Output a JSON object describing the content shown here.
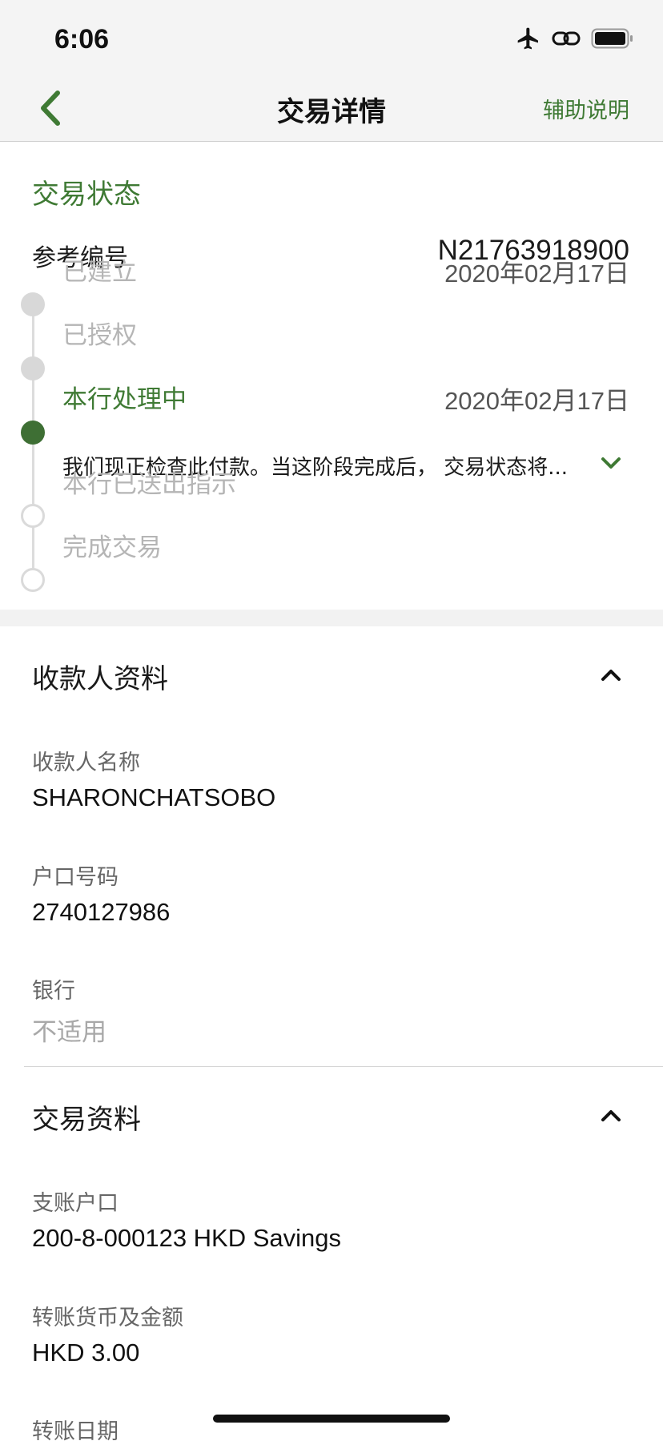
{
  "status_bar": {
    "time": "6:06",
    "icons": [
      "airplane-icon",
      "link-icon",
      "battery-icon"
    ]
  },
  "nav": {
    "title": "交易详情",
    "help_label": "辅助说明",
    "back_icon": "chevron-left-icon"
  },
  "transaction_status": {
    "heading": "交易状态",
    "reference_label": "参考编号",
    "reference_value": "N21763918900",
    "steps": [
      {
        "label": "已建立",
        "date": "2020年02月17日",
        "state": "done"
      },
      {
        "label": "已授权",
        "date": "",
        "state": "done"
      },
      {
        "label": "本行处理中",
        "date": "2020年02月17日",
        "state": "active",
        "description": "我们现正检查此付款。当这阶段完成后， 交易状态将..."
      },
      {
        "label": "本行已送出指示",
        "date": "",
        "state": "pending"
      },
      {
        "label": "完成交易",
        "date": "",
        "state": "pending"
      }
    ]
  },
  "payee_info": {
    "heading": "收款人资料",
    "fields": [
      {
        "label": "收款人名称",
        "value": "SHARONCHATSOBO"
      },
      {
        "label": "户口号码",
        "value": "2740127986"
      },
      {
        "label": "银行",
        "value": "不适用"
      }
    ]
  },
  "transaction_info": {
    "heading": "交易资料",
    "fields": [
      {
        "label": "支账户口",
        "value": "200-8-000123 HKD Savings"
      },
      {
        "label": "转账货币及金额",
        "value": "HKD 3.00"
      },
      {
        "label": "转账日期",
        "value": ""
      }
    ]
  },
  "colors": {
    "accent_green": "#3f7a34",
    "active_dot": "#3e6f34"
  }
}
